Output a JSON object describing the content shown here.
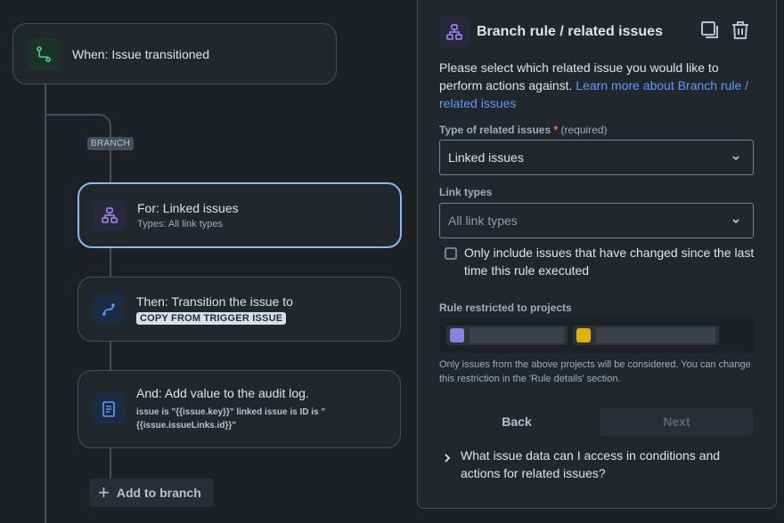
{
  "trigger": {
    "title": "When: Issue transitioned"
  },
  "branch_tag": "BRANCH",
  "branch_card": {
    "title": "For: Linked issues",
    "subtitle": "Types: All link types"
  },
  "transition_card": {
    "title": "Then: Transition the issue to",
    "lozenge": "COPY FROM TRIGGER ISSUE"
  },
  "log_card": {
    "title": "And: Add value to the audit log.",
    "text": "issue is \"{{issue.key}}\" linked issue is ID is \"{{issue.issueLinks.id}}\""
  },
  "add_branch": {
    "label": "Add to branch"
  },
  "panel": {
    "title": "Branch rule / related issues",
    "description": "Please select which related issue you would like to perform actions against. ",
    "learn_more": "Learn more about Branch rule / related issues",
    "type_label": "Type of related issues",
    "type_required_star": "*",
    "type_required_text": "(required)",
    "type_value": "Linked issues",
    "link_types_label": "Link types",
    "link_types_placeholder": "All link types",
    "checkbox_label": "Only include issues that have changed since the last time this rule executed",
    "checkbox_checked": false,
    "projects_label": "Rule restricted to projects",
    "projects_note": "Only issues from the above projects will be considered. You can change this restriction in the 'Rule details' section.",
    "back_label": "Back",
    "next_label": "Next",
    "faq": "What issue data can I access in conditions and actions for related issues?"
  },
  "colors": {
    "background": "#1d2125",
    "card": "#22272b",
    "selected_border": "#85b8ff",
    "link": "#579dff",
    "trigger_icon": "#4bce97",
    "branch_icon": "#9f8fef",
    "action_icon": "#579dff"
  },
  "icons": {
    "trigger": "flow-icon",
    "branch": "hierarchy-icon",
    "transition": "transition-icon",
    "log": "document-icon",
    "copy": "copy-icon",
    "delete": "trash-icon"
  }
}
